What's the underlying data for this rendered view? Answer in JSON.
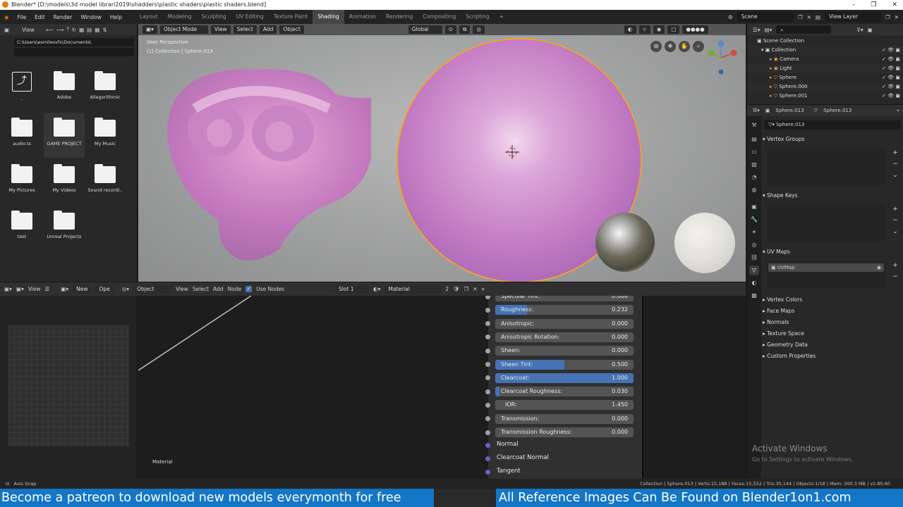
{
  "window": {
    "title": "Blender* [D:\\models\\3d model librari2019\\shadders\\plastic shaders\\plastic shaders.blend]",
    "controls": [
      "–",
      "❐",
      "✕"
    ]
  },
  "menubar": {
    "menus": [
      "File",
      "Edit",
      "Render",
      "Window",
      "Help"
    ],
    "workspaces": [
      "Layout",
      "Modeling",
      "Sculpting",
      "UV Editing",
      "Texture Paint",
      "Shading",
      "Animation",
      "Rendering",
      "Compositing",
      "Scripting"
    ],
    "active_workspace": "Shading",
    "add_tab": "+",
    "scene": "Scene",
    "view_layer": "View Layer"
  },
  "filebrowser": {
    "view_label": "View",
    "path": "C:\\Users\\esmilesvfx\\Documents\\",
    "items": [
      {
        "name": "..",
        "type": "parent"
      },
      {
        "name": "Adobe",
        "type": "folder"
      },
      {
        "name": "Allegorithmic",
        "type": "folder"
      },
      {
        "name": "audio.ts",
        "type": "folder"
      },
      {
        "name": "GAME PROJECT",
        "type": "folder"
      },
      {
        "name": "My Music",
        "type": "folder"
      },
      {
        "name": "My Pictures",
        "type": "folder"
      },
      {
        "name": "My Videos",
        "type": "folder"
      },
      {
        "name": "Sound recordi..",
        "type": "folder"
      },
      {
        "name": "test",
        "type": "folder"
      },
      {
        "name": "Unreal Projects",
        "type": "folder"
      }
    ]
  },
  "viewport": {
    "mode": "Object Mode",
    "menus": [
      "View",
      "Select",
      "Add",
      "Object"
    ],
    "orientation": "Global",
    "perspective": "User Perspective",
    "collection_info": "(1) Collection | Sphere.013",
    "sphere_color": "#c47cc3",
    "outline_color": "#f0a030"
  },
  "node_editor": {
    "header": {
      "editor_menu": "View",
      "new_label": "New",
      "open_label": "Ope",
      "object_label": "Object",
      "menus": [
        "View",
        "Select",
        "Add",
        "Node"
      ],
      "use_nodes": "Use Nodes",
      "slot": "Slot 1",
      "material": "Material",
      "users": "2"
    },
    "material_label": "Material",
    "inputs": [
      {
        "label": "Specular Tint:",
        "value": "0.000",
        "fill": 0,
        "highlight": false
      },
      {
        "label": "Roughness:",
        "value": "0.232",
        "fill": 0.232,
        "highlight": false
      },
      {
        "label": "Anisotropic:",
        "value": "0.000",
        "fill": 0,
        "highlight": false
      },
      {
        "label": "Anisotropic Rotation:",
        "value": "0.000",
        "fill": 0,
        "highlight": false
      },
      {
        "label": "Sheen:",
        "value": "0.000",
        "fill": 0,
        "highlight": false
      },
      {
        "label": "Sheen Tint:",
        "value": "0.500",
        "fill": 0.5,
        "highlight": false
      },
      {
        "label": "Clearcoat:",
        "value": "1.000",
        "fill": 1.0,
        "highlight": true
      },
      {
        "label": "Clearcoat Roughness:",
        "value": "0.030",
        "fill": 0.03,
        "highlight": false
      },
      {
        "label": "IOR:",
        "value": "1.450",
        "fill": 0,
        "highlight": false
      },
      {
        "label": "Transmission:",
        "value": "0.000",
        "fill": 0,
        "highlight": false
      },
      {
        "label": "Transmission Roughness:",
        "value": "0.000",
        "fill": 0,
        "highlight": false
      }
    ],
    "vector_inputs": [
      "Normal",
      "Clearcoat Normal",
      "Tangent"
    ]
  },
  "outliner": {
    "root": "Scene Collection",
    "items": [
      {
        "name": "Collection",
        "level": 1
      },
      {
        "name": "Camera",
        "level": 2
      },
      {
        "name": "Light",
        "level": 2
      },
      {
        "name": "Sphere",
        "level": 2
      },
      {
        "name": "Sphere.000",
        "level": 2
      },
      {
        "name": "Sphere.001",
        "level": 2
      }
    ]
  },
  "properties": {
    "object_name": "Sphere.013",
    "data_name": "Sphere.013",
    "mesh_field": "Sphere.013",
    "panels": {
      "vertex_groups": "Vertex Groups",
      "shape_keys": "Shape Keys",
      "uv_maps": "UV Maps",
      "uv_map_item": "UVMap",
      "vertex_colors": "Vertex Colors",
      "face_maps": "Face Maps",
      "normals": "Normals",
      "texture_space": "Texture Space",
      "geometry_data": "Geometry Data",
      "custom_properties": "Custom Properties"
    }
  },
  "watermark": {
    "line1": "Activate Windows",
    "line2": "Go to Settings to activate Windows."
  },
  "statusbar": {
    "left": "Axis Snap",
    "right": "Collection | Sphere.013 | Verts:15,188 | Faces:15,552 | Tris:30,144 | Objects:1/18 | Mem: 300.3 MB | v2.80.60"
  },
  "banner": {
    "left": "Become a patreon to download new models everymonth for free",
    "right": "All Reference Images Can Be Found on Blender1on1.com"
  }
}
